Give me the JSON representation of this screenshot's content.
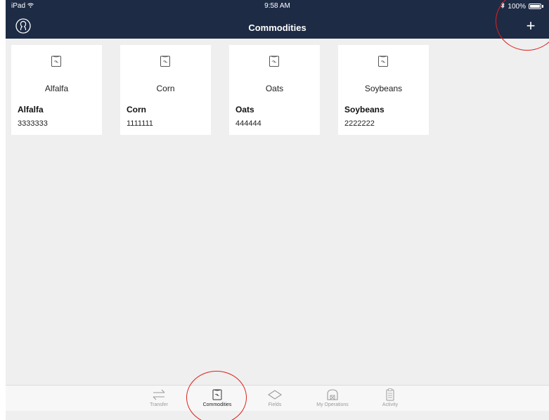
{
  "status_bar": {
    "device": "iPad",
    "time": "9:58 AM",
    "battery": "100%"
  },
  "nav": {
    "title": "Commodities",
    "add_label": "+"
  },
  "commodities": [
    {
      "title": "Alfalfa",
      "name": "Alfalfa",
      "code": "3333333"
    },
    {
      "title": "Corn",
      "name": "Corn",
      "code": "1111111"
    },
    {
      "title": "Oats",
      "name": "Oats",
      "code": "444444"
    },
    {
      "title": "Soybeans",
      "name": "Soybeans",
      "code": "2222222"
    }
  ],
  "tabs": [
    {
      "label": "Transfer",
      "icon": "transfer-icon"
    },
    {
      "label": "Commodities",
      "icon": "commodity-bag-icon",
      "active": true
    },
    {
      "label": "Fields",
      "icon": "fields-icon"
    },
    {
      "label": "My Operations",
      "icon": "barn-icon"
    },
    {
      "label": "Activity",
      "icon": "clipboard-icon"
    }
  ],
  "colors": {
    "nav_bg": "#1d2b45",
    "annotation": "#e0201b",
    "content_bg": "#efefef"
  }
}
